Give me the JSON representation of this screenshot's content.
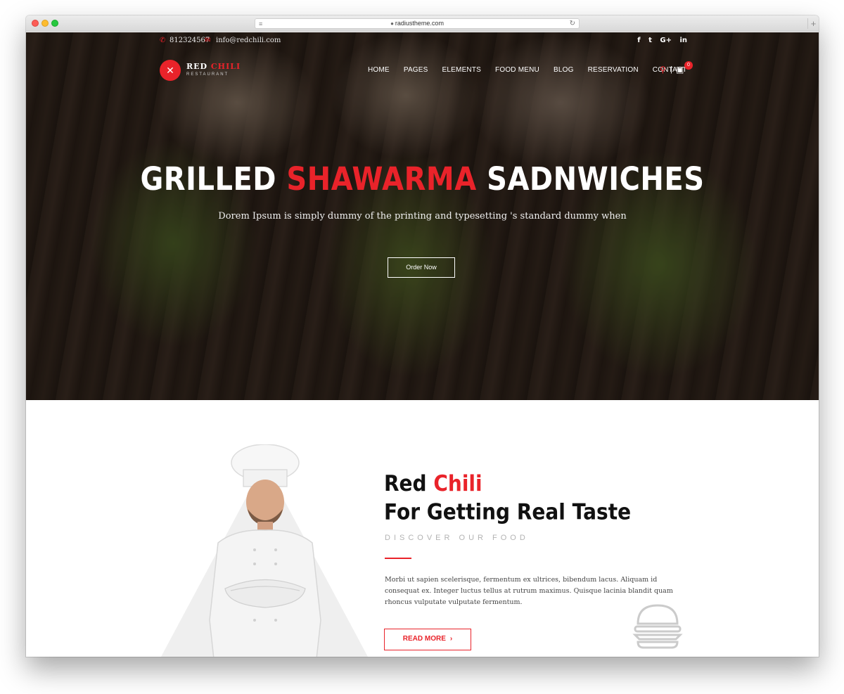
{
  "browser": {
    "url": "radiustheme.com",
    "reader_icon": "≡",
    "lock_icon": "🔒",
    "reload_icon": "↻",
    "new_tab": "+"
  },
  "topbar": {
    "phone": "812324567",
    "email": "info@redchili.com",
    "social": [
      "f",
      "t",
      "G+",
      "in"
    ]
  },
  "logo": {
    "name_main": "RED",
    "name_accent": "CHILI",
    "sub": "RESTAURANT"
  },
  "nav": {
    "items": [
      "HOME",
      "PAGES",
      "ELEMENTS",
      "FOOD MENU",
      "BLOG",
      "RESERVATION",
      "CONTACT"
    ],
    "divider": "|",
    "cart_count": "0"
  },
  "hero": {
    "title_before": "GRILLED ",
    "title_accent": "SHAWARMA",
    "title_after": " SADNWICHES",
    "subtitle": "Dorem Ipsum is simply dummy of the printing and typesetting 's standard dummy when",
    "button_label": "Order Now"
  },
  "about": {
    "title_line1_main": "Red ",
    "title_line1_accent": "Chili",
    "title_line2": "For Getting Real Taste",
    "tagline": "DISCOVER OUR FOOD",
    "text": "Morbi ut sapien scelerisque, fermentum ex ultrices, bibendum lacus. Aliquam id consequat ex. Integer luctus tellus at rutrum maximus. Quisque lacinia blandit quam rhoncus vulputate vulputate fermentum.",
    "button_label": "READ MORE",
    "button_chevron": "›"
  },
  "colors": {
    "accent": "#e9232a",
    "text_dark": "#111111",
    "muted": "#b3b3b3"
  }
}
